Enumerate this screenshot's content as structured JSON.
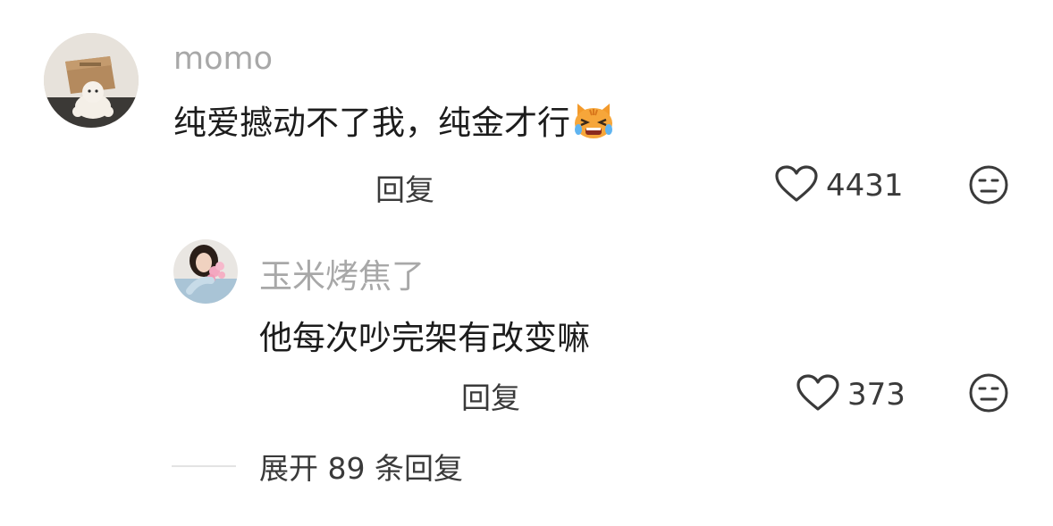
{
  "comments": [
    {
      "username": "momo",
      "text": "纯爱撼动不了我，纯金才行",
      "emoji": "crying-angry-cat-emoji",
      "reply_label": "回复",
      "like_count": "4431"
    }
  ],
  "replies": [
    {
      "username": "玉米烤焦了",
      "text": "他每次吵完架有改变嘛",
      "reply_label": "回复",
      "like_count": "373"
    }
  ],
  "expand": {
    "label": "展开 89 条回复"
  },
  "icons": {
    "like": "heart-outline-icon",
    "dislike": "meh-face-icon"
  },
  "colors": {
    "username": "#a8a8a8",
    "text": "#1c1c1c",
    "secondary": "#3a3a3a"
  }
}
